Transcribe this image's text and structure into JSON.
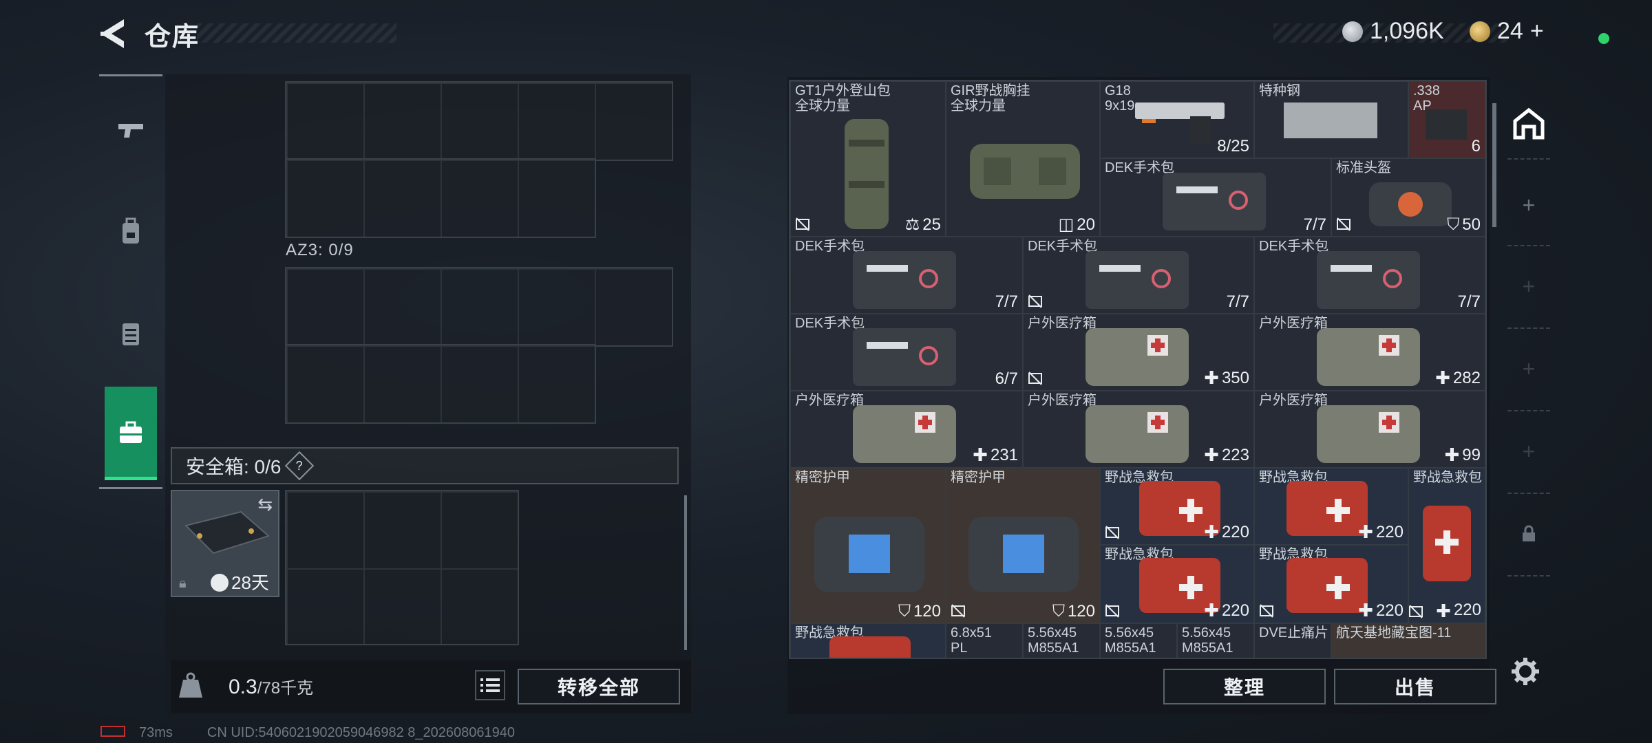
{
  "header": {
    "title": "仓库",
    "currency1": {
      "value": "1,096K",
      "icon": "silver-coin-icon"
    },
    "currency2": {
      "value": "24",
      "icon": "gold-coin-icon",
      "add": "+"
    }
  },
  "sidebar": {
    "items": [
      {
        "icon": "gun-icon"
      },
      {
        "icon": "backpack-icon"
      },
      {
        "icon": "vest-icon"
      },
      {
        "icon": "case-icon",
        "active": true
      }
    ]
  },
  "left": {
    "az_label": "AZ3: 0/9",
    "safe_label": "安全箱: 0/6",
    "safe_help": "?",
    "safe_days": "28天",
    "weight_value": "0.3",
    "weight_max": "/78千克",
    "transfer_all": "转移全部"
  },
  "items": [
    {
      "name": "GT1户外登山包\n全球力量",
      "val": "25",
      "icon": "weight-icon",
      "nosell": true
    },
    {
      "name": "GIR野战胸挂\n全球力量",
      "val": "20",
      "icon": "vest-small-icon"
    },
    {
      "name": "G18\n9x19mm",
      "val": "8/25"
    },
    {
      "name": "特种钢",
      "val": ""
    },
    {
      "name": ".338\nAP",
      "val": "6"
    },
    {
      "name": "DEK手术包",
      "val": "7/7"
    },
    {
      "name": "标准头盔",
      "val": "50",
      "icon": "shield-icon",
      "nosell": true
    },
    {
      "name": "DEK手术包",
      "val": "7/7"
    },
    {
      "name": "DEK手术包",
      "val": "7/7",
      "nosell": true
    },
    {
      "name": "DEK手术包",
      "val": "7/7"
    },
    {
      "name": "DEK手术包",
      "val": "6/7"
    },
    {
      "name": "户外医疗箱",
      "val": "350",
      "icon": "plus-icon",
      "nosell": true
    },
    {
      "name": "户外医疗箱",
      "val": "282",
      "icon": "plus-icon"
    },
    {
      "name": "户外医疗箱",
      "val": "231",
      "icon": "plus-icon"
    },
    {
      "name": "户外医疗箱",
      "val": "223",
      "icon": "plus-icon"
    },
    {
      "name": "户外医疗箱",
      "val": "99",
      "icon": "plus-icon"
    },
    {
      "name": "精密护甲",
      "val": "120",
      "icon": "shield-icon"
    },
    {
      "name": "精密护甲",
      "val": "120",
      "icon": "shield-icon",
      "nosell": true
    },
    {
      "name": "野战急救包",
      "val": "220",
      "icon": "plus-icon",
      "nosell": true
    },
    {
      "name": "野战急救包",
      "val": "220",
      "icon": "plus-icon"
    },
    {
      "name": "野战急救包",
      "val": ""
    },
    {
      "name": "野战急救包",
      "val": "220",
      "icon": "plus-icon",
      "nosell": true
    },
    {
      "name": "野战急救包",
      "val": "220",
      "icon": "plus-icon",
      "nosell": true
    },
    {
      "name": "",
      "val": "220",
      "icon": "plus-icon",
      "nosell": true
    },
    {
      "name": "野战急救包",
      "val": ""
    },
    {
      "name": "6.8x51\nPL",
      "val": ""
    },
    {
      "name": "5.56x45\nM855A1",
      "val": ""
    },
    {
      "name": "5.56x45\nM855A1",
      "val": ""
    },
    {
      "name": "5.56x45\nM855A1",
      "val": ""
    },
    {
      "name": "DVE止痛片",
      "val": ""
    },
    {
      "name": "航天基地藏宝图-11",
      "val": ""
    }
  ],
  "buttons": {
    "sort": "整理",
    "sell": "出售"
  },
  "footer": {
    "ping": "73ms",
    "uid": "CN UID:5406021902059046982 8_202608061940"
  },
  "colors": {
    "accent": "#16905f",
    "status": "#2fd36b"
  }
}
